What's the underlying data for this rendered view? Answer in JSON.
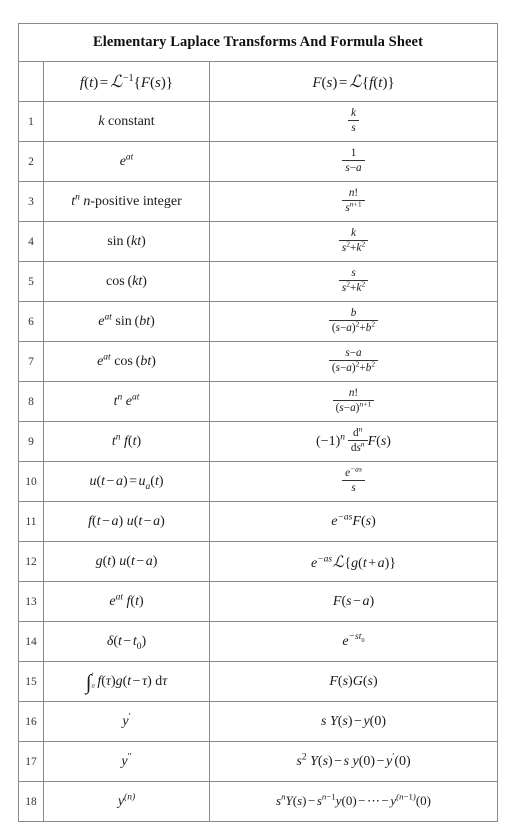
{
  "document": {
    "title": "Elementary Laplace Transforms And Formula Sheet",
    "columns": {
      "index_header": "",
      "ft_header": "f(t) = ℒ⁻¹{F(s)}",
      "fs_header": "F(s) = ℒ{f(t)}"
    }
  },
  "rows": [
    {
      "n": "1",
      "ft": "k constant",
      "fs": "k/s"
    },
    {
      "n": "2",
      "ft": "e^(at)",
      "fs": "1/(s−a)"
    },
    {
      "n": "3",
      "ft": "t^n  n-positive integer",
      "fs": "n!/s^(n+1)"
    },
    {
      "n": "4",
      "ft": "sin (kt)",
      "fs": "k/(s²+k²)"
    },
    {
      "n": "5",
      "ft": "cos (kt)",
      "fs": "s/(s²+k²)"
    },
    {
      "n": "6",
      "ft": "e^(at) sin (bt)",
      "fs": "b/((s−a)²+b²)"
    },
    {
      "n": "7",
      "ft": "e^(at) cos (bt)",
      "fs": "(s−a)/((s−a)²+b²)"
    },
    {
      "n": "8",
      "ft": "t^n e^(at)",
      "fs": "n!/((s−a)^(n+1))"
    },
    {
      "n": "9",
      "ft": "t^n f(t)",
      "fs": "(−1)^n d^n/ds^n F(s)"
    },
    {
      "n": "10",
      "ft": "u(t − a) = u_a(t)",
      "fs": "e^(−as)/s"
    },
    {
      "n": "11",
      "ft": "f(t − a) u(t − a)",
      "fs": "e^(−as) F(s)"
    },
    {
      "n": "12",
      "ft": "g(t) u(t − a)",
      "fs": "e^(−as) ℒ{g(t + a)}"
    },
    {
      "n": "13",
      "ft": "e^(at) f(t)",
      "fs": "F(s − a)"
    },
    {
      "n": "14",
      "ft": "δ(t − t₀)",
      "fs": "e^(−st₀)"
    },
    {
      "n": "15",
      "ft": "∫₀ᵗ f(τ)g(t − τ) dτ",
      "fs": "F(s)G(s)"
    },
    {
      "n": "16",
      "ft": "y′",
      "fs": "s Y(s) − y(0)"
    },
    {
      "n": "17",
      "ft": "y″",
      "fs": "s² Y(s) − s y(0) − y′(0)"
    },
    {
      "n": "18",
      "ft": "y^(n)",
      "fs": "sⁿY(s) − s^(n−1)y(0) − ⋯ − y^(n−1)(0)"
    }
  ],
  "style": {
    "border_color": "#8a8a8a",
    "outer_border_color": "#555555",
    "text_color": "#1a1a1a",
    "background": "#ffffff"
  }
}
